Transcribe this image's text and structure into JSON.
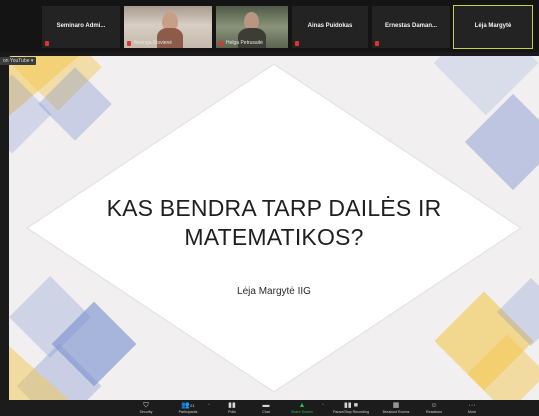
{
  "gallery": {
    "participants": [
      {
        "name": "Seminaro Admi...",
        "muted": true,
        "video": false
      },
      {
        "name": "Neringa Klovienė",
        "muted": true,
        "video": true
      },
      {
        "name": "Helga Petrusaitė",
        "muted": true,
        "video": true
      },
      {
        "name": "Ainas Puidokas",
        "muted": true,
        "video": false
      },
      {
        "name": "Ernestas Daman...",
        "muted": true,
        "video": false
      },
      {
        "name": "Lėja Margytė",
        "muted": false,
        "video": false,
        "active": true
      }
    ]
  },
  "share": {
    "label": "on YouTube ▾"
  },
  "slide": {
    "title_line1": "KAS BENDRA TARP DAILĖS IR",
    "title_line2": "MATEMATIKOS?",
    "author": "Lėja Margytė IIG",
    "colors": {
      "background": "#f1eff0",
      "blue": "#7f93cf",
      "yellow": "#f4c74f"
    }
  },
  "toolbar": {
    "items": [
      {
        "label": "Security",
        "icon": "shield-icon"
      },
      {
        "label": "Participants",
        "icon": "participants-icon",
        "count": "21"
      },
      {
        "label": "Polls",
        "icon": "polls-icon"
      },
      {
        "label": "Chat",
        "icon": "chat-icon"
      },
      {
        "label": "Share Screen",
        "icon": "share-screen-icon"
      },
      {
        "label": "Pause/Stop Recording",
        "icon": "recording-icon"
      },
      {
        "label": "Breakout Rooms",
        "icon": "breakout-rooms-icon"
      },
      {
        "label": "Reactions",
        "icon": "reactions-icon"
      },
      {
        "label": "More",
        "icon": "more-icon"
      }
    ]
  }
}
